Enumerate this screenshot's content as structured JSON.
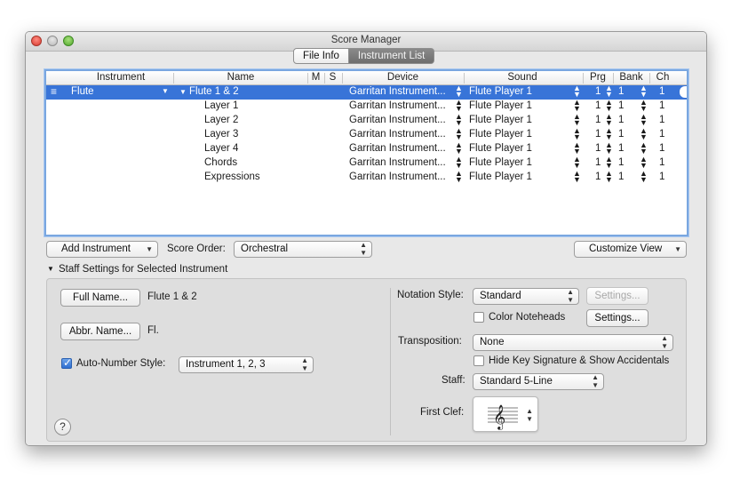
{
  "window": {
    "title": "Score Manager"
  },
  "tabs": [
    {
      "label": "File Info"
    },
    {
      "label": "Instrument List"
    }
  ],
  "table": {
    "headers": {
      "instrument": "Instrument",
      "name": "Name",
      "m": "M",
      "s": "S",
      "device": "Device",
      "sound": "Sound",
      "prg": "Prg",
      "bank": "Bank",
      "ch": "Ch"
    },
    "selected_row": {
      "instrument": "Flute",
      "name": "Flute 1 & 2",
      "device": "Garritan Instrument...",
      "sound": "Flute Player 1",
      "prg": "1",
      "bank": "1",
      "ch": "1"
    },
    "rows": [
      {
        "name": "Layer 1",
        "device": "Garritan Instrument...",
        "sound": "Flute Player 1",
        "prg": "1",
        "bank": "1",
        "ch": "1"
      },
      {
        "name": "Layer 2",
        "device": "Garritan Instrument...",
        "sound": "Flute Player 1",
        "prg": "1",
        "bank": "1",
        "ch": "1"
      },
      {
        "name": "Layer 3",
        "device": "Garritan Instrument...",
        "sound": "Flute Player 1",
        "prg": "1",
        "bank": "1",
        "ch": "1"
      },
      {
        "name": "Layer 4",
        "device": "Garritan Instrument...",
        "sound": "Flute Player 1",
        "prg": "1",
        "bank": "1",
        "ch": "1"
      },
      {
        "name": "Chords",
        "device": "Garritan Instrument...",
        "sound": "Flute Player 1",
        "prg": "1",
        "bank": "1",
        "ch": "1"
      },
      {
        "name": "Expressions",
        "device": "Garritan Instrument...",
        "sound": "Flute Player 1",
        "prg": "1",
        "bank": "1",
        "ch": "1"
      }
    ]
  },
  "toolbar": {
    "add_instrument": "Add Instrument",
    "score_order_label": "Score Order:",
    "score_order_value": "Orchestral",
    "customize_view": "Customize View"
  },
  "staff_settings": {
    "header": "Staff Settings for Selected Instrument",
    "full_name_button": "Full Name...",
    "full_name_value": "Flute 1 & 2",
    "abbr_name_button": "Abbr. Name...",
    "abbr_name_value": "Fl.",
    "auto_number_label": "Auto-Number Style:",
    "auto_number_checked": true,
    "auto_number_value": "Instrument 1, 2, 3",
    "notation_style_label": "Notation Style:",
    "notation_style_value": "Standard",
    "settings_label": "Settings...",
    "color_noteheads_label": "Color Noteheads",
    "transposition_label": "Transposition:",
    "transposition_value": "None",
    "hide_key_sig_label": "Hide Key Signature & Show Accidentals",
    "staff_label": "Staff:",
    "staff_value": "Standard 5-Line",
    "first_clef_label": "First Clef:",
    "first_clef_glyph": "𝄞",
    "help": "?"
  },
  "colors": {
    "selection": "#3874d8",
    "focus_ring": "#7aa7e0",
    "checkbox_on": "#2f6fd0"
  }
}
